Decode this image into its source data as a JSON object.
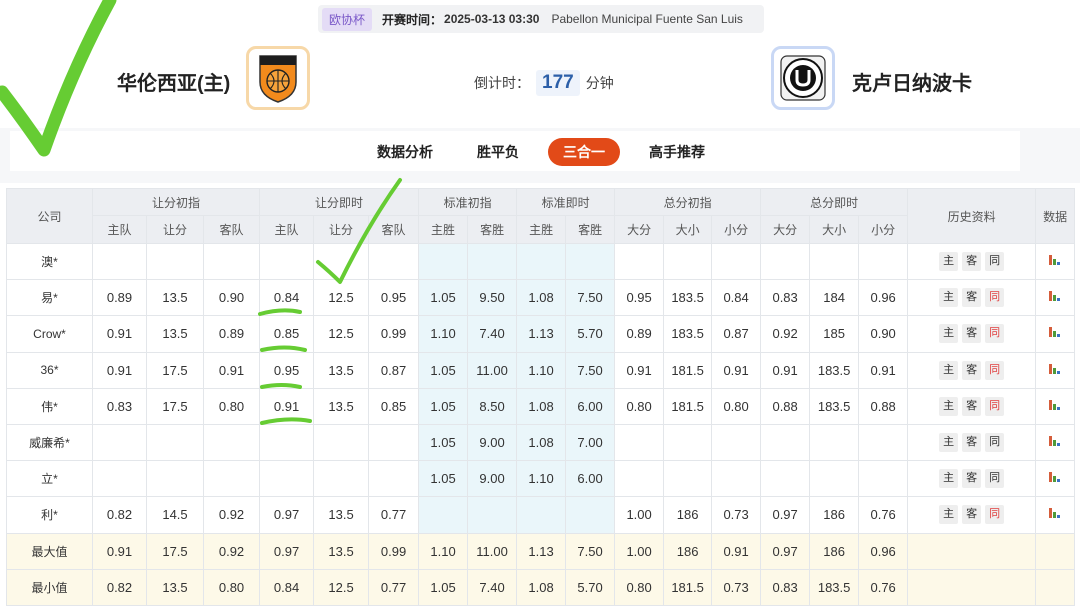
{
  "match": {
    "league": "欧协杯",
    "kickoff_label": "开赛时间：",
    "kickoff_time": "2025-03-13 03:30",
    "venue": "Pabellon Municipal Fuente San Luis",
    "home_team": "华伦西亚(主)",
    "away_team": "克卢日纳波卡",
    "home_logo": "valencia-basketball-crest",
    "away_logo": "u-cluj-crest",
    "countdown_label": "倒计时：",
    "countdown_value": "177",
    "countdown_unit": "分钟"
  },
  "tabs": [
    {
      "label": "数据分析",
      "active": false
    },
    {
      "label": "胜平负",
      "active": false
    },
    {
      "label": "三合一",
      "active": true
    },
    {
      "label": "高手推荐",
      "active": false
    }
  ],
  "colors": {
    "accent": "#e24a18",
    "odds_blue": "#2e6bb6",
    "annotation_green": "#66cc33"
  },
  "table": {
    "groups": [
      "公司",
      "让分初指",
      "让分即时",
      "标准初指",
      "标准即时",
      "总分初指",
      "总分即时",
      "历史资料",
      "数据"
    ],
    "subheaders": [
      "主队",
      "让分",
      "客队",
      "主队",
      "让分",
      "客队",
      "主胜",
      "客胜",
      "主胜",
      "客胜",
      "大分",
      "大小",
      "小分",
      "大分",
      "大小",
      "小分"
    ],
    "history_buttons": [
      "主",
      "客",
      "同"
    ],
    "data_icon": "bar-chart-icon",
    "rows": [
      {
        "company": "澳*",
        "cells": [
          "",
          "",
          "",
          "",
          "",
          "",
          "",
          "",
          "",
          "",
          "",
          "",
          "",
          "",
          "",
          ""
        ]
      },
      {
        "company": "易*",
        "cells": [
          "0.89",
          "13.5",
          "0.90",
          "0.84",
          "12.5",
          "0.95",
          "1.05",
          "9.50",
          "1.08",
          "7.50",
          "0.95",
          "183.5",
          "0.84",
          "0.83",
          "184",
          "0.96"
        ]
      },
      {
        "company": "Crow*",
        "cells": [
          "0.91",
          "13.5",
          "0.89",
          "0.85",
          "12.5",
          "0.99",
          "1.10",
          "7.40",
          "1.13",
          "5.70",
          "0.89",
          "183.5",
          "0.87",
          "0.92",
          "185",
          "0.90"
        ]
      },
      {
        "company": "36*",
        "cells": [
          "0.91",
          "17.5",
          "0.91",
          "0.95",
          "13.5",
          "0.87",
          "1.05",
          "11.00",
          "1.10",
          "7.50",
          "0.91",
          "181.5",
          "0.91",
          "0.91",
          "183.5",
          "0.91"
        ]
      },
      {
        "company": "伟*",
        "cells": [
          "0.83",
          "17.5",
          "0.80",
          "0.91",
          "13.5",
          "0.85",
          "1.05",
          "8.50",
          "1.08",
          "6.00",
          "0.80",
          "181.5",
          "0.80",
          "0.88",
          "183.5",
          "0.88"
        ]
      },
      {
        "company": "威廉希*",
        "cells": [
          "",
          "",
          "",
          "",
          "",
          "",
          "1.05",
          "9.00",
          "1.08",
          "7.00",
          "",
          "",
          "",
          "",
          "",
          ""
        ]
      },
      {
        "company": "立*",
        "cells": [
          "",
          "",
          "",
          "",
          "",
          "",
          "1.05",
          "9.00",
          "1.10",
          "6.00",
          "",
          "",
          "",
          "",
          "",
          ""
        ]
      },
      {
        "company": "利*",
        "cells": [
          "0.82",
          "14.5",
          "0.92",
          "0.97",
          "13.5",
          "0.77",
          "",
          "",
          "",
          "",
          "1.00",
          "186",
          "0.73",
          "0.97",
          "186",
          "0.76"
        ]
      }
    ],
    "summary": [
      {
        "label": "最大值",
        "cells": [
          "0.91",
          "17.5",
          "0.92",
          "0.97",
          "13.5",
          "0.99",
          "1.10",
          "11.00",
          "1.13",
          "7.50",
          "1.00",
          "186",
          "0.91",
          "0.97",
          "186",
          "0.96"
        ]
      },
      {
        "label": "最小值",
        "cells": [
          "0.82",
          "13.5",
          "0.80",
          "0.84",
          "12.5",
          "0.77",
          "1.05",
          "7.40",
          "1.08",
          "5.70",
          "0.80",
          "181.5",
          "0.73",
          "0.83",
          "183.5",
          "0.76"
        ]
      }
    ]
  }
}
